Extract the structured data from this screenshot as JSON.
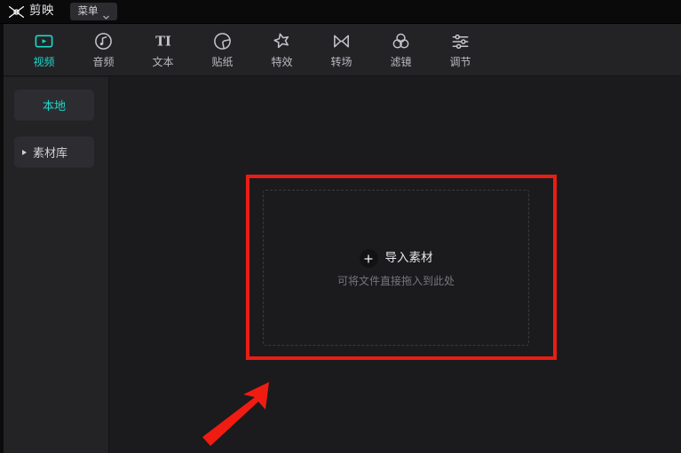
{
  "app": {
    "brand_name": "剪映",
    "logo_icon": "capcut-logo-icon",
    "background_color": "#1b1b1d",
    "panel_color": "#232326",
    "accent_color": "#23d5c8",
    "annotation_color": "#ea1d14"
  },
  "titlebar": {
    "menu_button_label": "菜单",
    "menu_chevron_icon": "chevron-down-icon"
  },
  "toolbar": {
    "tabs": [
      {
        "label": "视频",
        "icon": "video-icon",
        "active": true
      },
      {
        "label": "音频",
        "icon": "audio-note-icon",
        "active": false
      },
      {
        "label": "文本",
        "icon": "text-ti-icon",
        "active": false
      },
      {
        "label": "贴纸",
        "icon": "sticker-icon",
        "active": false
      },
      {
        "label": "特效",
        "icon": "effects-star-icon",
        "active": false
      },
      {
        "label": "转场",
        "icon": "transition-bowtie-icon",
        "active": false
      },
      {
        "label": "滤镜",
        "icon": "filter-circles-icon",
        "active": false
      },
      {
        "label": "调节",
        "icon": "adjust-sliders-icon",
        "active": false
      }
    ]
  },
  "sidebar": {
    "items": [
      {
        "label": "本地",
        "active": true,
        "expandable": false
      },
      {
        "label": "素材库",
        "active": false,
        "expandable": true,
        "icon": "triangle-right-icon"
      }
    ]
  },
  "main": {
    "dropzone": {
      "import_label": "导入素材",
      "plus_icon": "plus-icon",
      "hint_label": "可将文件直接拖入到此处"
    }
  },
  "annotations": {
    "highlight_box": {
      "name": "red-highlight-rectangle",
      "color": "#ea1d14"
    },
    "arrow": {
      "name": "red-pointer-arrow",
      "color": "#f01c12",
      "direction": "up-right"
    }
  }
}
